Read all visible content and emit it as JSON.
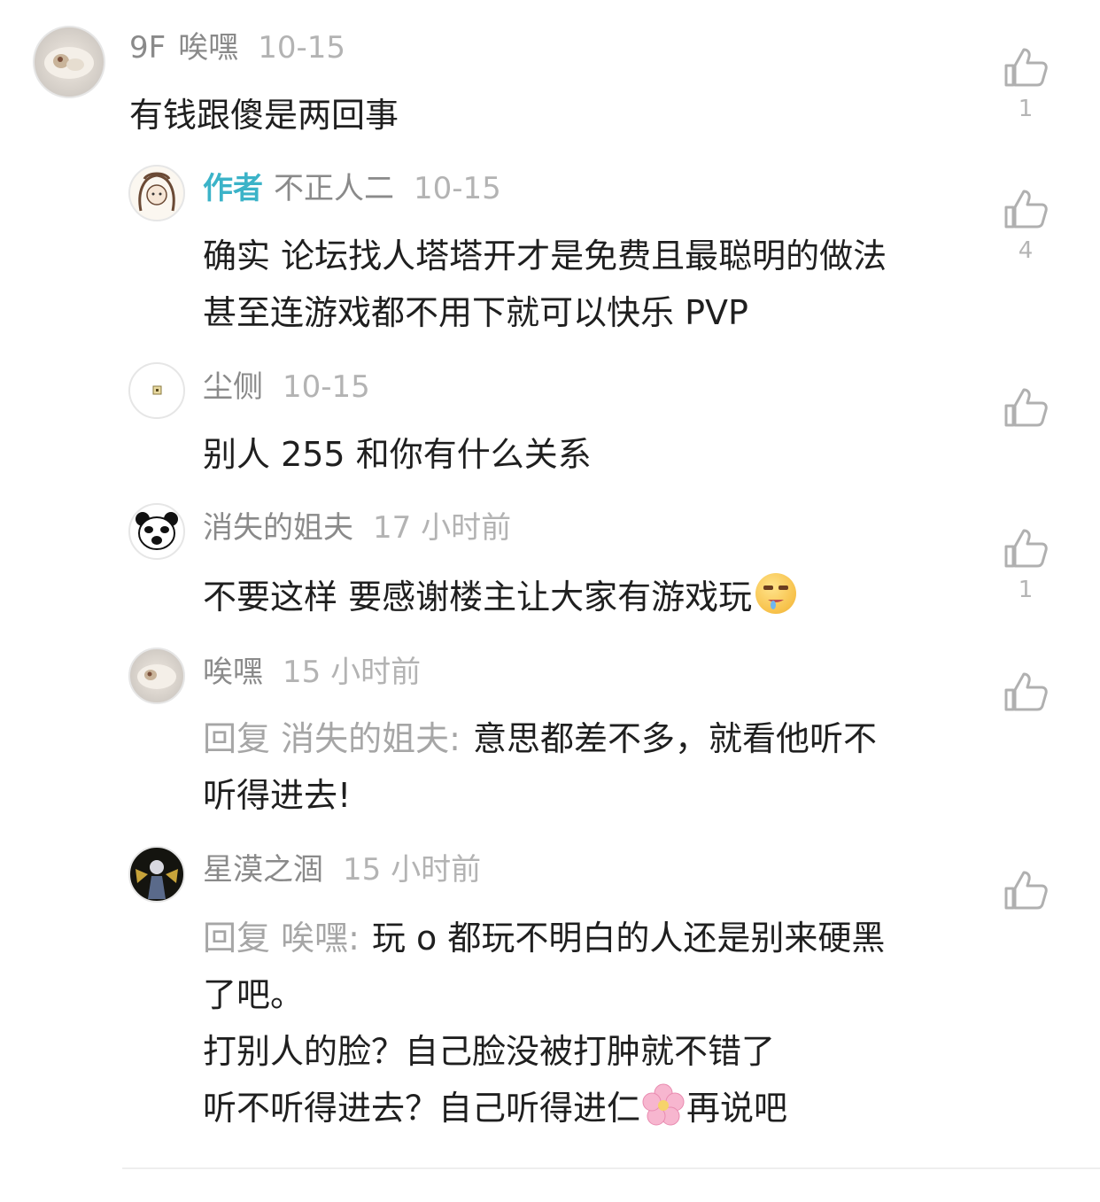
{
  "comments": [
    {
      "floor": "9F",
      "name": "唉嘿",
      "time": "10-15",
      "lines": [
        "有钱跟傻是两回事"
      ],
      "likes": "1",
      "avatar_icon": "dumpling-avatar-icon"
    }
  ],
  "replies": [
    {
      "author_tag": "作者",
      "name": "不正人二",
      "time": "10-15",
      "lines": [
        "确实 论坛找人塔塔开才是免费且最聪明的做法",
        "甚至连游戏都不用下就可以快乐 PVP"
      ],
      "likes": "4",
      "avatar_icon": "sketch-girl-avatar-icon"
    },
    {
      "name": "尘侧",
      "time": "10-15",
      "lines": [
        "别人 255 和你有什么关系"
      ],
      "likes": "",
      "avatar_icon": "tiny-pixel-avatar-icon"
    },
    {
      "name": "消失的姐夫",
      "time": "17 小时前",
      "line_with_emoji": "不要这样 要感谢楼主让大家有游戏玩",
      "emoji": "drooling-face-emoji-icon",
      "likes": "1",
      "avatar_icon": "panda-meme-avatar-icon"
    },
    {
      "name": "唉嘿",
      "time": "15 小时前",
      "reply_label": "回复",
      "reply_to": "消失的姐夫",
      "reply_colon": ":",
      "lines": [
        "意思都差不多，就看他听不",
        "听得进去!"
      ],
      "likes": "",
      "avatar_icon": "dumpling-avatar-icon"
    },
    {
      "name": "星漠之涸",
      "time": "15 小时前",
      "reply_label": "回复",
      "reply_to": "唉嘿",
      "reply_colon": ":",
      "lines": [
        "玩 o 都玩不明白的人还是别来硬黑",
        "了吧。",
        "打别人的脸？自己脸没被打肿就不错了"
      ],
      "last_line_before": "听不听得进去？自己听得进仁",
      "last_line_emoji": "cherry-blossom-emoji-icon",
      "last_line_after": "再说吧",
      "likes": "",
      "avatar_icon": "dark-character-avatar-icon"
    }
  ],
  "colors": {
    "author_tag": "#3bb3c8",
    "meta_gray": "#a6a6a6",
    "text": "#1f1f1f",
    "like_icon": "#b0b0b0"
  }
}
